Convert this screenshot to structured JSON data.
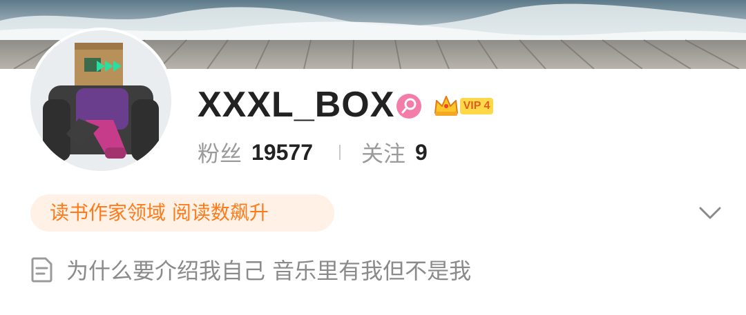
{
  "profile": {
    "username": "XXXL_BOX",
    "gender_icon": "female-icon",
    "vip": {
      "label": "VIP 4",
      "icon": "crown-icon"
    },
    "stats": {
      "followers_label": "粉丝",
      "followers_value": "19577",
      "following_label": "关注",
      "following_value": "9"
    },
    "tag": "读书作家领域 阅读数飙升",
    "bio_icon": "document-icon",
    "bio": "为什么要介绍我自己 音乐里有我但不是我",
    "expand_icon": "chevron-down-icon"
  },
  "colors": {
    "accent_orange": "#ff7a1a",
    "tag_background": "#fff1e6",
    "female_pink": "#f37ca8",
    "vip_gold": "#ffd84a"
  }
}
